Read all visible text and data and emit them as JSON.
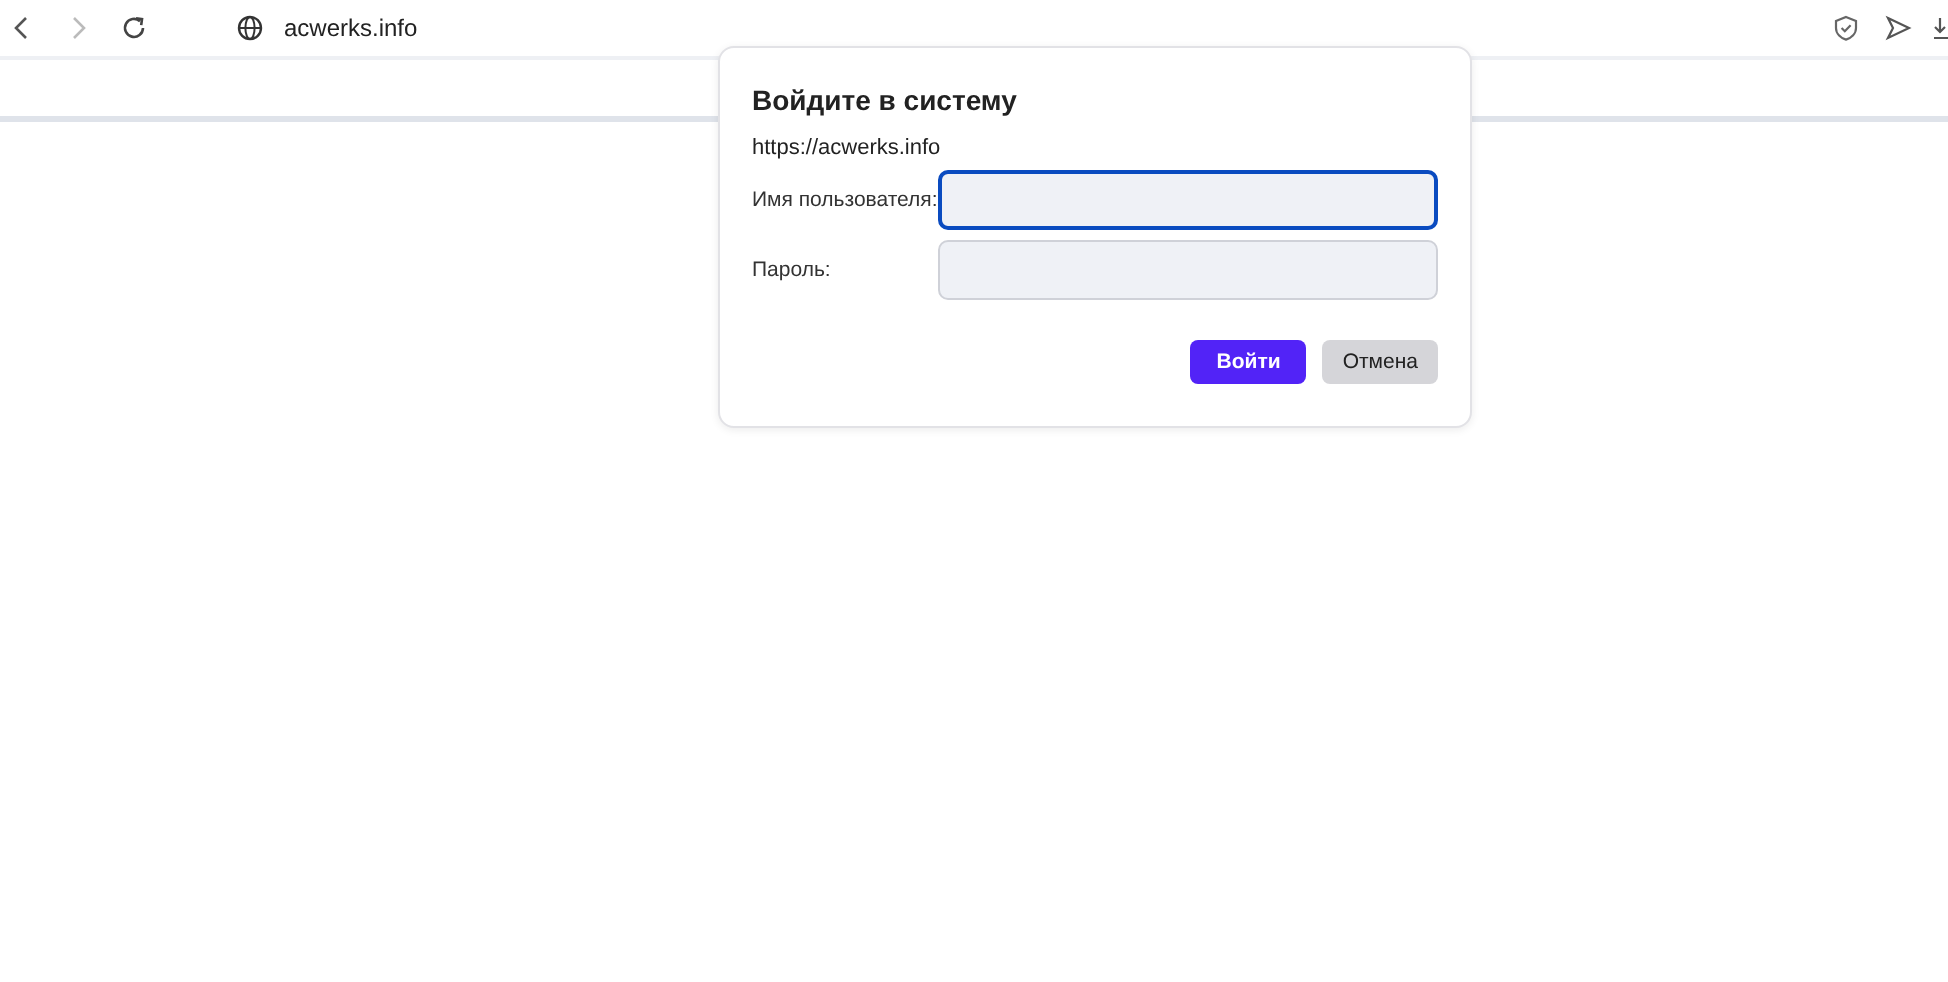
{
  "toolbar": {
    "url": "acwerks.info"
  },
  "dialog": {
    "title": "Войдите в систему",
    "origin": "https://acwerks.info",
    "fields": [
      {
        "label": "Имя пользователя:",
        "focused": true
      },
      {
        "label": "Пароль:",
        "focused": false
      }
    ],
    "buttons": [
      {
        "label": "Войти",
        "kind": "primary"
      },
      {
        "label": "Отмена",
        "kind": "secondary"
      }
    ]
  }
}
